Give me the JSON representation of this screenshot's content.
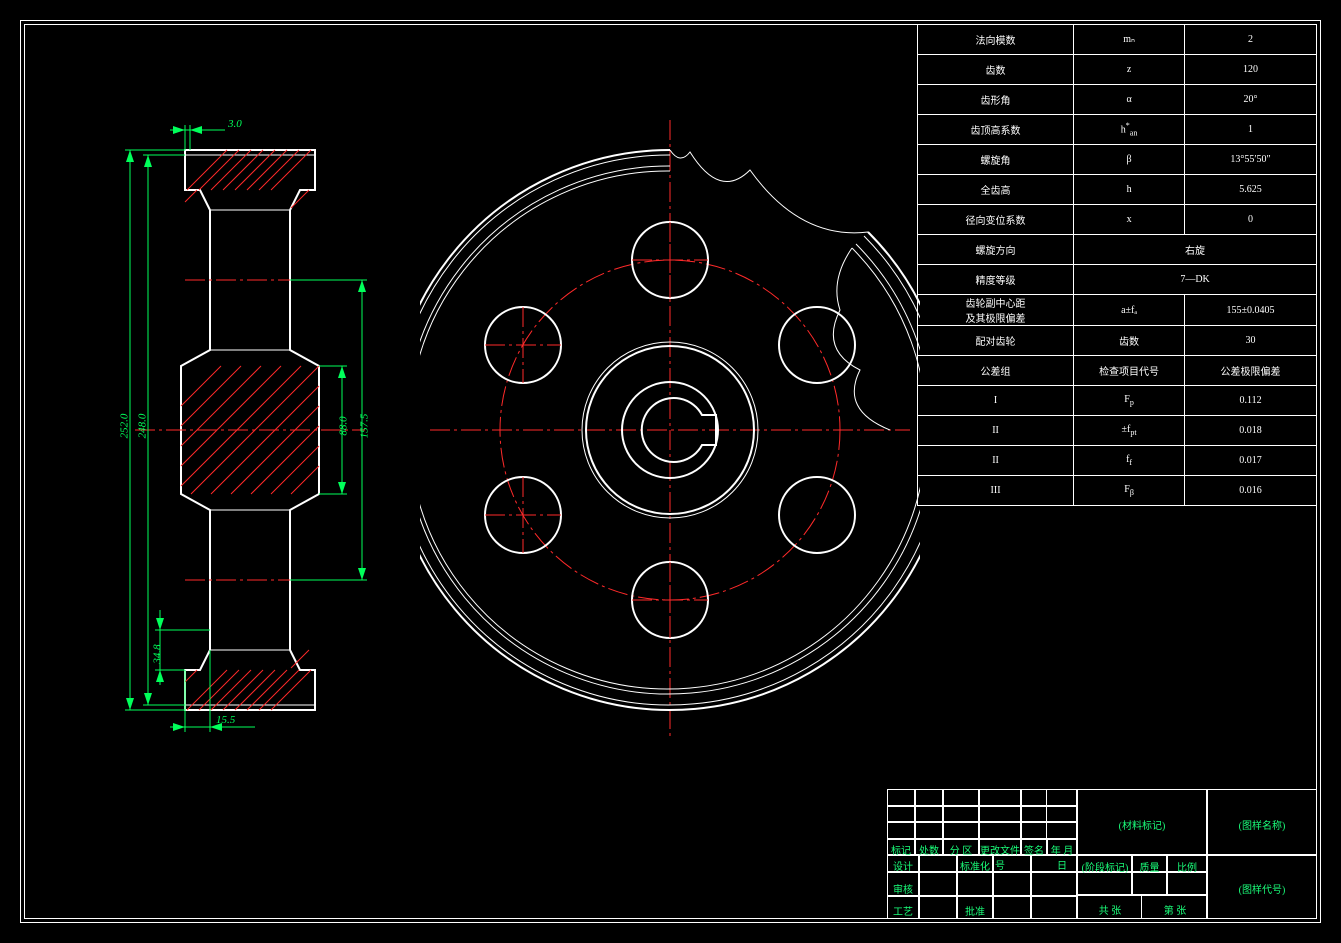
{
  "params": {
    "rows": [
      {
        "name": "法向模数",
        "sym": "mₙ",
        "val": "2"
      },
      {
        "name": "齿数",
        "sym": "z",
        "val": "120"
      },
      {
        "name": "齿形角",
        "sym": "α",
        "val": "20°"
      },
      {
        "name": "齿顶高系数",
        "sym": "hₐₙ*",
        "val": "1"
      },
      {
        "name": "螺旋角",
        "sym": "β",
        "val": "13°55′50″"
      },
      {
        "name": "全齿高",
        "sym": "h",
        "val": "5.625"
      },
      {
        "name": "径向变位系数",
        "sym": "x",
        "val": "0"
      }
    ],
    "span": [
      {
        "name": "螺旋方向",
        "val": "右旋"
      },
      {
        "name": "精度等级",
        "val": "7—DK"
      }
    ],
    "center": {
      "name_l1": "齿轮副中心距",
      "name_l2": "及其极限偏差",
      "sym": "a±fₐ",
      "val": "155±0.0405"
    },
    "mate": {
      "name": "配对齿轮",
      "sym": "齿数",
      "val": "30"
    },
    "tolhdr": {
      "name": "公差组",
      "sym": "检查项目代号",
      "val": "公差极限偏差"
    },
    "tol": [
      {
        "grp": "I",
        "sym": "Fₚ",
        "val": "0.112"
      },
      {
        "grp": "II",
        "sym": "±fₚₜ",
        "val": "0.018"
      },
      {
        "grp": "II",
        "sym": "fբ",
        "val": "0.017"
      },
      {
        "grp": "III",
        "sym": "Fᵦ",
        "val": "0.016"
      }
    ]
  },
  "title_block": {
    "hdr": [
      "标记",
      "处数",
      "分 区",
      "更改文件号",
      "签名",
      "年 月 日"
    ],
    "rows_l": [
      "设计",
      "审核",
      "工艺"
    ],
    "rows_m": [
      "标准化",
      "",
      "批准"
    ],
    "mat": "(材料标记)",
    "stage": "(阶段标记)",
    "mass": "质量",
    "scale": "比例",
    "name": "(图样名称)",
    "code": "(图样代号)",
    "sheet_l": "共  张",
    "sheet_r": "第  张"
  },
  "dims": {
    "d252": "252.0",
    "d248": "248.0",
    "d88": "88.0",
    "d157": "157.5",
    "w3": "3.0",
    "w15": "15.5",
    "h34": "34.8"
  }
}
